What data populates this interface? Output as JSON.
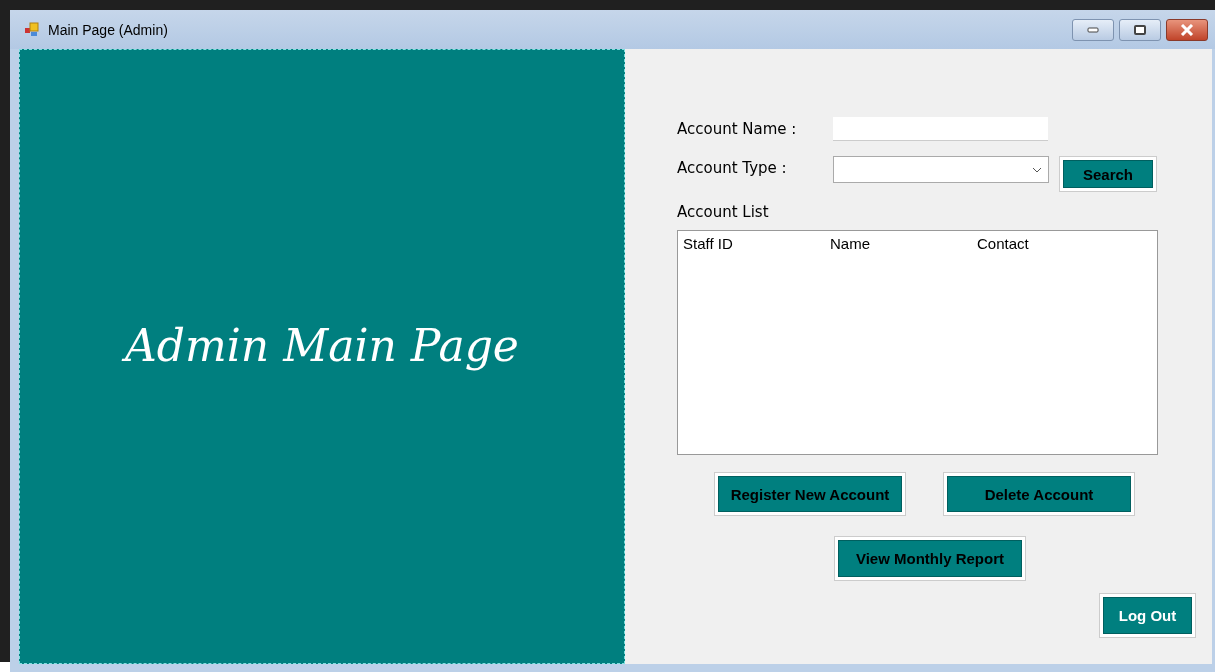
{
  "window": {
    "title": "Main Page (Admin)"
  },
  "banner": {
    "title": "Admin Main Page"
  },
  "form": {
    "fields": [
      {
        "label": "Account Name :",
        "kind": "text"
      },
      {
        "label": "Account Type :",
        "kind": "dropdown"
      }
    ],
    "search_button": "Search",
    "list_label": "Account List",
    "list_columns": [
      "Staff ID",
      "Name",
      "Contact"
    ]
  },
  "buttons": [
    {
      "label": "Register New Account",
      "kind": "dark-text"
    },
    {
      "label": "Delete Account",
      "kind": "dark-text"
    },
    {
      "label": "View Monthly Report",
      "kind": "dark-text"
    },
    {
      "label": "Log Out",
      "kind": "light-text"
    }
  ]
}
